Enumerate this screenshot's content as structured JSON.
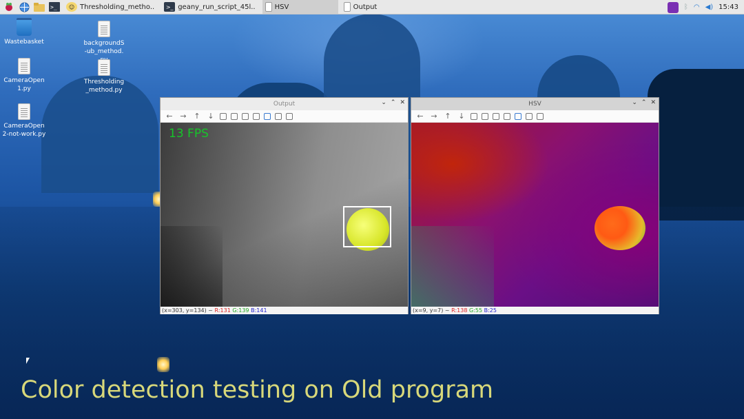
{
  "taskbar": {
    "tasks": [
      {
        "label": "Thresholding_metho..",
        "icon": "python-icon"
      },
      {
        "label": "geany_run_script_45l..",
        "icon": "terminal-icon"
      },
      {
        "label": "HSV",
        "icon": "window-icon"
      },
      {
        "label": "Output",
        "icon": "window-icon"
      }
    ],
    "clock": "15:43"
  },
  "desktop_icons": [
    {
      "label": "Wastebasket",
      "icon": "trash-icon"
    },
    {
      "label": "CameraOpen1.py",
      "icon": "file-icon"
    },
    {
      "label": "CameraOpen2-not-work.py",
      "icon": "file-icon"
    },
    {
      "label": "backgroundS-ub_method.py",
      "icon": "file-icon"
    },
    {
      "label": "Thresholding_method.py",
      "icon": "file-icon"
    }
  ],
  "windows": {
    "output": {
      "title": "Output",
      "fps_text": "13 FPS",
      "status": {
        "coords": "(x=303, y=134) ~ ",
        "r": "R:131",
        "g": "G:139",
        "b": "B:141"
      }
    },
    "hsv": {
      "title": "HSV",
      "status": {
        "coords": "(x=9, y=7) ~ ",
        "r": "R:138",
        "g": "G:55",
        "b": "B:25"
      }
    }
  },
  "caption": "Color detection testing on Old program",
  "colors": {
    "caption": "#d8d87a",
    "fps": "#17c52a",
    "taskbar": "#e8e8e8"
  }
}
